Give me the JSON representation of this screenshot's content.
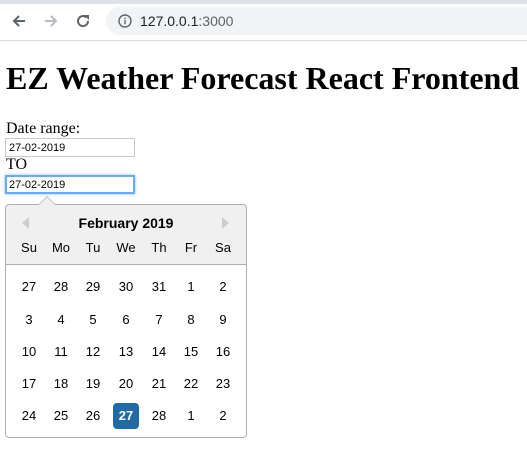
{
  "browser": {
    "url_host": "127.0.0.1",
    "url_port": ":3000",
    "back_icon": "arrow-left-icon",
    "forward_icon": "arrow-right-icon",
    "reload_icon": "reload-icon",
    "info_icon": "info-icon"
  },
  "page": {
    "title": "EZ Weather Forecast React Frontend",
    "date_range_label": "Date range:",
    "start_date_value": "27-02-2019",
    "to_label": "TO",
    "end_date_value": "27-02-2019"
  },
  "datepicker": {
    "month_label": "February 2019",
    "weekdays": [
      "Su",
      "Mo",
      "Tu",
      "We",
      "Th",
      "Fr",
      "Sa"
    ],
    "weeks": [
      [
        "27",
        "28",
        "29",
        "30",
        "31",
        "1",
        "2"
      ],
      [
        "3",
        "4",
        "5",
        "6",
        "7",
        "8",
        "9"
      ],
      [
        "10",
        "11",
        "12",
        "13",
        "14",
        "15",
        "16"
      ],
      [
        "17",
        "18",
        "19",
        "20",
        "21",
        "22",
        "23"
      ],
      [
        "24",
        "25",
        "26",
        "27",
        "28",
        "1",
        "2"
      ]
    ],
    "selected_day": "27",
    "accent_color": "#216ba5"
  }
}
